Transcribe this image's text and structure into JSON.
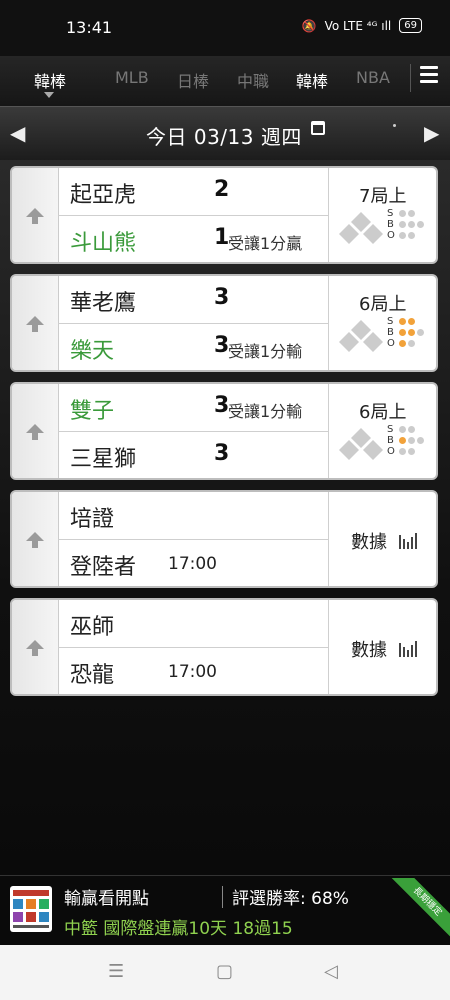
{
  "status_bar": {
    "time": "13:41",
    "signal": "Vo LTE ⁴ᴳ ıll",
    "battery": "69"
  },
  "tabs": {
    "items": [
      {
        "label": "韓棒",
        "active": true
      },
      {
        "label": "MLB",
        "active": false
      },
      {
        "label": "日棒",
        "active": false
      },
      {
        "label": "中職",
        "active": false
      },
      {
        "label": "韓棒",
        "active": false,
        "bright": true
      },
      {
        "label": "NBA",
        "active": false
      }
    ]
  },
  "date_bar": {
    "label": "今日 03/13 週四",
    "prev": "◀",
    "next": "▶"
  },
  "games": [
    {
      "team_top": "起亞虎",
      "score_top": "2",
      "handicap_top": "",
      "team_bottom": "斗山熊",
      "score_bottom": "1",
      "handicap_bottom": "受讓1分贏",
      "winner": "bottom",
      "inning": "7局上",
      "sbo": {
        "s": 0,
        "b": 0,
        "o": 0
      }
    },
    {
      "team_top": "華老鷹",
      "score_top": "3",
      "handicap_top": "",
      "team_bottom": "樂天",
      "score_bottom": "3",
      "handicap_bottom": "受讓1分輸",
      "winner": "bottom",
      "inning": "6局上",
      "sbo": {
        "s": 2,
        "b": 2,
        "o": 1
      }
    },
    {
      "team_top": "雙子",
      "score_top": "3",
      "handicap_top": "受讓1分輸",
      "team_bottom": "三星獅",
      "score_bottom": "3",
      "handicap_bottom": "",
      "winner": "top",
      "inning": "6局上",
      "sbo": {
        "s": 0,
        "b": 1,
        "o": 0
      }
    },
    {
      "team_top": "培證",
      "team_bottom": "登陸者",
      "time": "17:00",
      "stats_label": "數據"
    },
    {
      "team_top": "巫師",
      "team_bottom": "恐龍",
      "time": "17:00",
      "stats_label": "數據"
    }
  ],
  "sbo_labels": {
    "s": "S",
    "b": "B",
    "o": "O"
  },
  "ad": {
    "title": "輸贏看開點",
    "rate": "評選勝率: 68%",
    "line": "中籃 國際盤連贏10天 18過15",
    "ribbon": "長期穩定"
  },
  "colors": {
    "win_team": "#3a9a3a",
    "sbo_on": "#f2a23a",
    "ad_line": "#8fd14f"
  }
}
